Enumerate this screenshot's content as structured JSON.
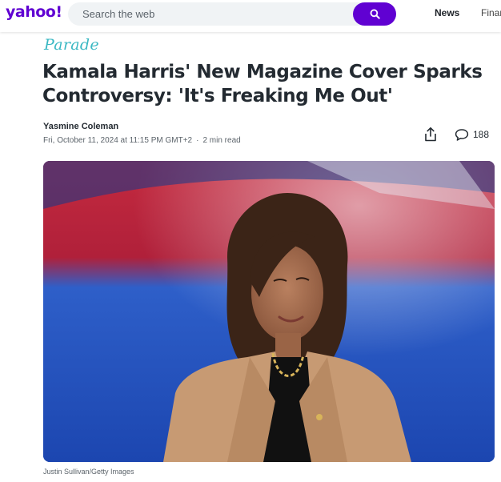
{
  "header": {
    "logo": "yahoo!",
    "search": {
      "placeholder": "Search the web",
      "value": ""
    },
    "nav": [
      {
        "label": "News"
      },
      {
        "label": "Finar"
      }
    ]
  },
  "article": {
    "source": "Parade",
    "headline": "Kamala Harris' New Magazine Cover Sparks Controversy: 'It's Freaking Me Out'",
    "author": "Yasmine Coleman",
    "date": "Fri, October 11, 2024 at 11:15 PM GMT+2",
    "separator": "·",
    "read_time": "2 min read",
    "comment_count": "188",
    "image_caption": "Justin Sullivan/Getty Images"
  },
  "colors": {
    "brand": "#6001d2",
    "source": "#3ab8c3",
    "text": "#232a31",
    "muted": "#5b636a"
  },
  "icons": [
    "search-icon",
    "share-icon",
    "comment-icon"
  ]
}
